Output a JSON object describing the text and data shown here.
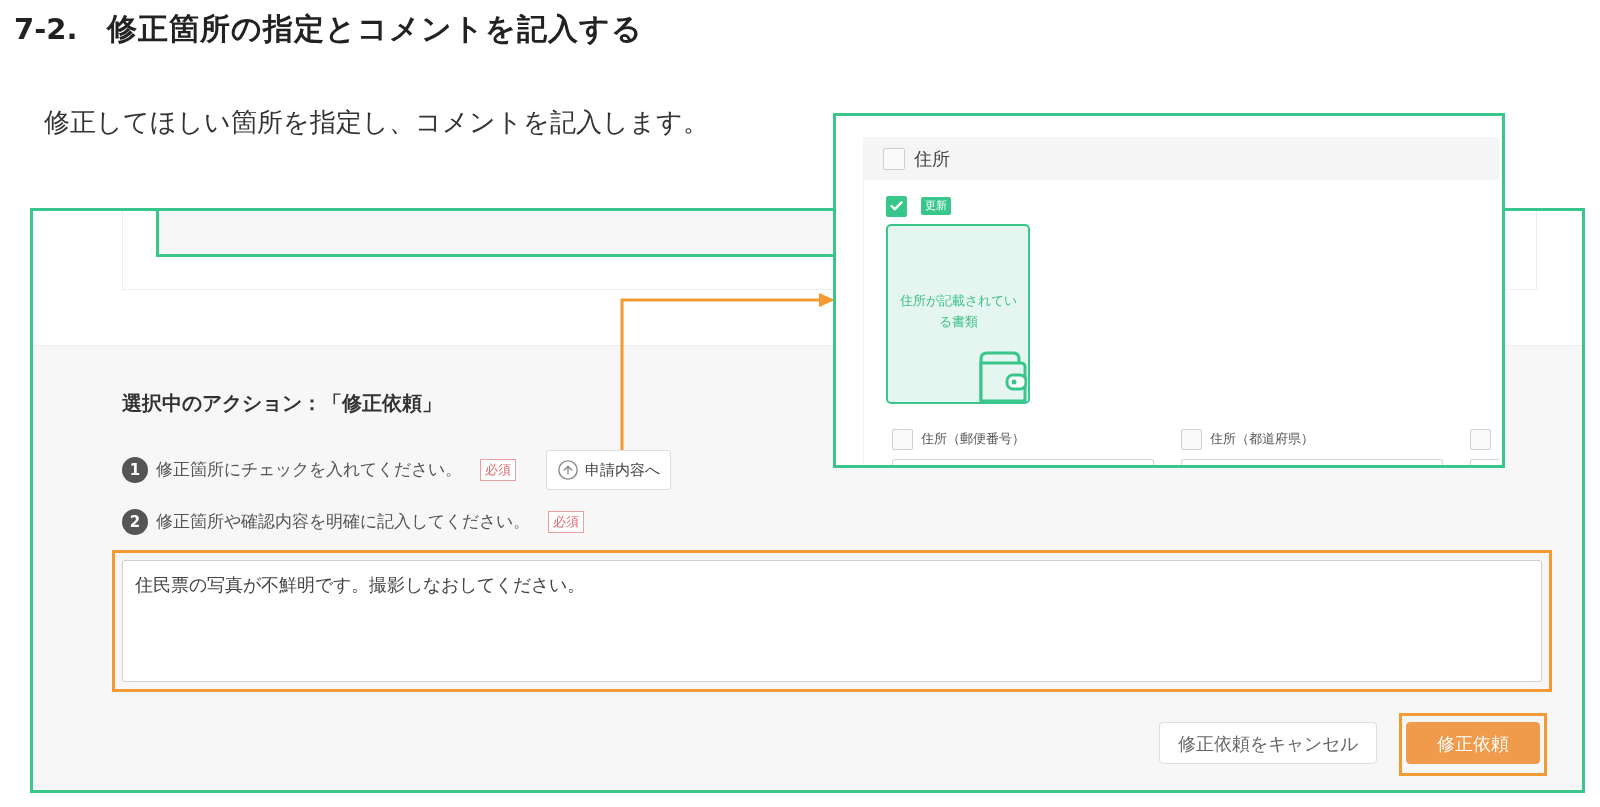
{
  "heading": {
    "number": "7-2.",
    "title": "修正箇所の指定とコメントを記入する"
  },
  "intro": "修正してほしい箇所を指定し、コメントを記入します。",
  "screen": {
    "action_label": "選択中のアクション：「修正依頼」",
    "steps": [
      {
        "number": "1",
        "text": "修正箇所にチェックを入れてください。",
        "badge": "必須",
        "button": "申請内容へ"
      },
      {
        "number": "2",
        "text": "修正箇所や確認内容を明確に記入してください。",
        "badge": "必須"
      }
    ],
    "comment": {
      "value": "住民票の写真が不鮮明です。撮影しなおしてください。",
      "highlighted": true
    },
    "buttons": [
      {
        "label": "修正依頼をキャンセル",
        "kind": "secondary",
        "highlighted": false
      },
      {
        "label": "修正依頼",
        "kind": "primary",
        "highlighted": true
      }
    ]
  },
  "inset": {
    "section": {
      "label": "住所",
      "checked": false
    },
    "document": {
      "checked": true,
      "badge": "更新",
      "label": "住所が記載されている書類"
    },
    "fields": [
      {
        "label": "住所（郵便番号）",
        "checked": false
      },
      {
        "label": "住所（都道府県）",
        "checked": false
      },
      {
        "checked": false
      }
    ]
  }
}
